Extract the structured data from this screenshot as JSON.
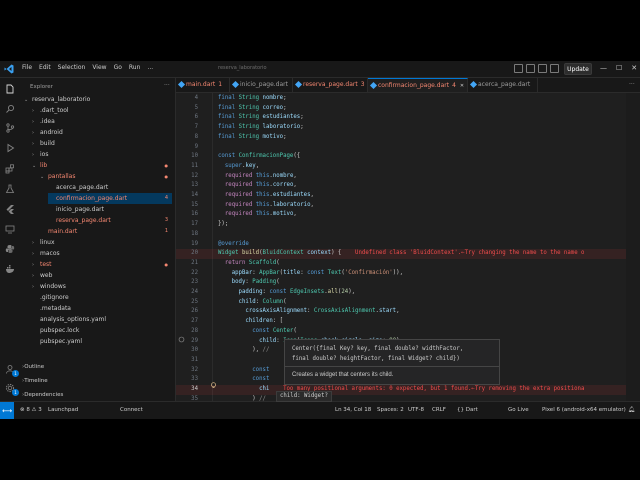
{
  "menu": [
    "File",
    "Edit",
    "Selection",
    "View",
    "Go",
    "Run",
    "..."
  ],
  "window_title": "reserva_laboratorio",
  "update_label": "Update",
  "window_controls": [
    "—",
    "☐",
    "✕"
  ],
  "sidebar": {
    "title": "Explorer",
    "root": "reserva_laboratorio",
    "tree": [
      {
        "label": ".dart_tool",
        "depth": 1,
        "type": "folder",
        "color": "#cccccc"
      },
      {
        "label": ".idea",
        "depth": 1,
        "type": "folder",
        "color": "#cccccc"
      },
      {
        "label": "android",
        "depth": 1,
        "type": "folder",
        "color": "#cccccc"
      },
      {
        "label": "build",
        "depth": 1,
        "type": "folder",
        "color": "#cccccc"
      },
      {
        "label": "ios",
        "depth": 1,
        "type": "folder",
        "color": "#cccccc"
      },
      {
        "label": "lib",
        "depth": 1,
        "type": "folder-open",
        "color": "#f48771",
        "badge": ""
      },
      {
        "label": "pantallas",
        "depth": 2,
        "type": "folder-open",
        "color": "#f48771",
        "badge": ""
      },
      {
        "label": "acerca_page.dart",
        "depth": 3,
        "type": "file",
        "color": "#cccccc"
      },
      {
        "label": "confirmacion_page.dart",
        "depth": 3,
        "type": "file",
        "color": "#f48771",
        "badge": "4",
        "selected": true
      },
      {
        "label": "inicio_page.dart",
        "depth": 3,
        "type": "file",
        "color": "#cccccc"
      },
      {
        "label": "reserva_page.dart",
        "depth": 3,
        "type": "file",
        "color": "#f48771",
        "badge": "3"
      },
      {
        "label": "main.dart",
        "depth": 2,
        "type": "file",
        "color": "#f48771",
        "badge": "1"
      },
      {
        "label": "linux",
        "depth": 1,
        "type": "folder",
        "color": "#cccccc"
      },
      {
        "label": "macos",
        "depth": 1,
        "type": "folder",
        "color": "#cccccc"
      },
      {
        "label": "test",
        "depth": 1,
        "type": "folder",
        "color": "#f48771",
        "badge": ""
      },
      {
        "label": "web",
        "depth": 1,
        "type": "folder",
        "color": "#cccccc"
      },
      {
        "label": "windows",
        "depth": 1,
        "type": "folder",
        "color": "#cccccc"
      },
      {
        "label": ".gitignore",
        "depth": 1,
        "type": "file",
        "color": "#cccccc"
      },
      {
        "label": ".metadata",
        "depth": 1,
        "type": "file",
        "color": "#cccccc"
      },
      {
        "label": "analysis_options.yaml",
        "depth": 1,
        "type": "file",
        "color": "#cccccc"
      },
      {
        "label": "pubspec.lock",
        "depth": 1,
        "type": "file",
        "color": "#cccccc"
      },
      {
        "label": "pubspec.yaml",
        "depth": 1,
        "type": "file",
        "color": "#cccccc"
      }
    ],
    "sections": [
      "Outline",
      "Timeline",
      "Dependencies"
    ]
  },
  "tabs": [
    {
      "label": "main.dart",
      "badge": "1"
    },
    {
      "label": "inicio_page.dart",
      "badge": ""
    },
    {
      "label": "reserva_page.dart",
      "badge": "3"
    },
    {
      "label": "confirmacion_page.dart",
      "badge": "4",
      "active": true
    },
    {
      "label": "acerca_page.dart",
      "badge": ""
    }
  ],
  "code_lines": [
    {
      "n": "4",
      "html": "<span class='kw'>final</span> <span class='ty'>String</span> <span class='id'>nombre</span>;"
    },
    {
      "n": "5",
      "html": "<span class='kw'>final</span> <span class='ty'>String</span> <span class='id'>correo</span>;"
    },
    {
      "n": "6",
      "html": "<span class='kw'>final</span> <span class='ty'>String</span> <span class='id'>estudiantes</span>;"
    },
    {
      "n": "7",
      "html": "<span class='kw'>final</span> <span class='ty'>String</span> <span class='id'>laboratorio</span>;"
    },
    {
      "n": "8",
      "html": "<span class='kw'>final</span> <span class='ty'>String</span> <span class='id'>motivo</span>;"
    },
    {
      "n": "9",
      "html": ""
    },
    {
      "n": "10",
      "html": "<span class='kw'>const</span> <span class='ty'>ConfirmacionPage</span>({"
    },
    {
      "n": "11",
      "html": "  <span class='kw'>super</span>.<span class='id'>key</span>,"
    },
    {
      "n": "12",
      "html": "  <span class='kw2'>required</span> <span class='kw'>this</span>.<span class='id'>nombre</span>,"
    },
    {
      "n": "13",
      "html": "  <span class='kw2'>required</span> <span class='kw'>this</span>.<span class='id'>correo</span>,"
    },
    {
      "n": "14",
      "html": "  <span class='kw2'>required</span> <span class='kw'>this</span>.<span class='id'>estudiantes</span>,"
    },
    {
      "n": "15",
      "html": "  <span class='kw2'>required</span> <span class='kw'>this</span>.<span class='id'>laboratorio</span>,"
    },
    {
      "n": "16",
      "html": "  <span class='kw2'>required</span> <span class='kw'>this</span>.<span class='id'>motivo</span>,"
    },
    {
      "n": "17",
      "html": "});"
    },
    {
      "n": "18",
      "html": ""
    },
    {
      "n": "19",
      "html": "<span class='an'>@override</span>"
    },
    {
      "n": "20",
      "err": true,
      "html": "<span class='ty'>Widget</span> <span class='fn'>build</span>(<span class='ty'>BluidContext</span> <span class='id'>context</span>) {    <span class='errmsg'>Undefined class 'BluidContext'.←Try changing the name to the name o</span>"
    },
    {
      "n": "21",
      "html": "  <span class='kw2'>return</span> <span class='ty'>Scaffold</span>("
    },
    {
      "n": "22",
      "html": "    <span class='id'>appBar</span>: <span class='ty'>AppBar</span>(<span class='id'>title</span>: <span class='kw'>const</span> <span class='ty'>Text</span>(<span class='st'>'Confirmación'</span>)),"
    },
    {
      "n": "23",
      "html": "    <span class='id'>body</span>: <span class='ty'>Padding</span>("
    },
    {
      "n": "24",
      "html": "      <span class='id'>padding</span>: <span class='kw'>const</span> <span class='ty'>EdgeInsets</span>.<span class='fn'>all</span>(<span class='nu'>24</span>),"
    },
    {
      "n": "25",
      "html": "      <span class='id'>child</span>: <span class='ty'>Column</span>("
    },
    {
      "n": "26",
      "html": "        <span class='id'>crossAxisAlignment</span>: <span class='ty'>CrossAxisAlignment</span>.<span class='id'>start</span>,"
    },
    {
      "n": "27",
      "html": "        <span class='id'>children</span>: ["
    },
    {
      "n": "28",
      "html": "          <span class='kw'>const</span> <span class='ty'>Center</span>("
    },
    {
      "n": "29",
      "html": "            <span class='id'>child</span>: <span class='ty'>Icon</span>(<span class='ty'>Icons</span>.<span class='id'>check_circle</span>, <span class='id'>size</span>: <span class='nu'>90</span>),"
    },
    {
      "n": "30",
      "html": "          ), <span class='ghost'>//</span>"
    },
    {
      "n": "31",
      "html": ""
    },
    {
      "n": "32",
      "html": "          <span class='kw'>const</span>"
    },
    {
      "n": "33",
      "html": "          <span class='kw'>const</span>"
    },
    {
      "n": "34",
      "err": true,
      "cur": true,
      "html": "            <span class='id'>chi</span>    <span class='errmsg'>Too many positional arguments: 0 expected, but 1 found.←Try removing the extra positiona</span>"
    },
    {
      "n": "35",
      "html": "          ) <span class='ghost'>//</span>"
    }
  ],
  "hover": {
    "signature_line1": "Center({final Key? key, final double? widthFactor,",
    "signature_line2": "final double? heightFactor, final Widget? child})",
    "doc": "Creates a widget that centers its child."
  },
  "inlay_hint": "child: Widget?",
  "status": {
    "left": [
      {
        "icon": "warning-icon",
        "label": "⊗ 8  ⚠ 3"
      },
      {
        "icon": "launchpad-icon",
        "label": "Launchpad"
      },
      {
        "icon": "connect-icon",
        "label": "Connect"
      }
    ],
    "right": [
      "Ln 34, Col 18",
      "Spaces: 2",
      "UTF-8",
      "CRLF",
      "{} Dart",
      "Go Live",
      "Pixel 6 (android-x64 emulator)"
    ]
  },
  "colors": {
    "accent": "#0078d4",
    "error": "#f14c4c",
    "modified": "#f48771"
  }
}
